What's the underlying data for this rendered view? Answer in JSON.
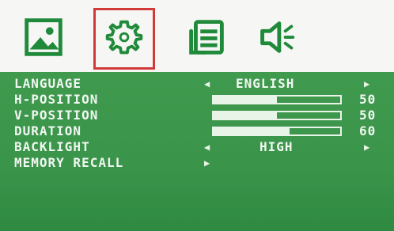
{
  "tabs": [
    {
      "name": "picture-tab",
      "icon": "image-icon"
    },
    {
      "name": "settings-tab",
      "icon": "gear-icon"
    },
    {
      "name": "info-tab",
      "icon": "document-icon"
    },
    {
      "name": "audio-tab",
      "icon": "speaker-icon"
    }
  ],
  "menu": {
    "language": {
      "label": "LANGUAGE",
      "value": "ENGLISH"
    },
    "hpos": {
      "label": "H-POSITION",
      "value": "50",
      "level": 0.5
    },
    "vpos": {
      "label": "V-POSITION",
      "value": "50",
      "level": 0.5
    },
    "duration": {
      "label": "DURATION",
      "value": "60",
      "level": 0.6
    },
    "backlight": {
      "label": "BACKLIGHT",
      "value": "HIGH"
    },
    "memory": {
      "label": "MEMORY RECALL"
    }
  },
  "colors": {
    "menu_green": "#3a944a",
    "selection_red": "#d23a3a",
    "icon_green": "#1f8a3a"
  }
}
